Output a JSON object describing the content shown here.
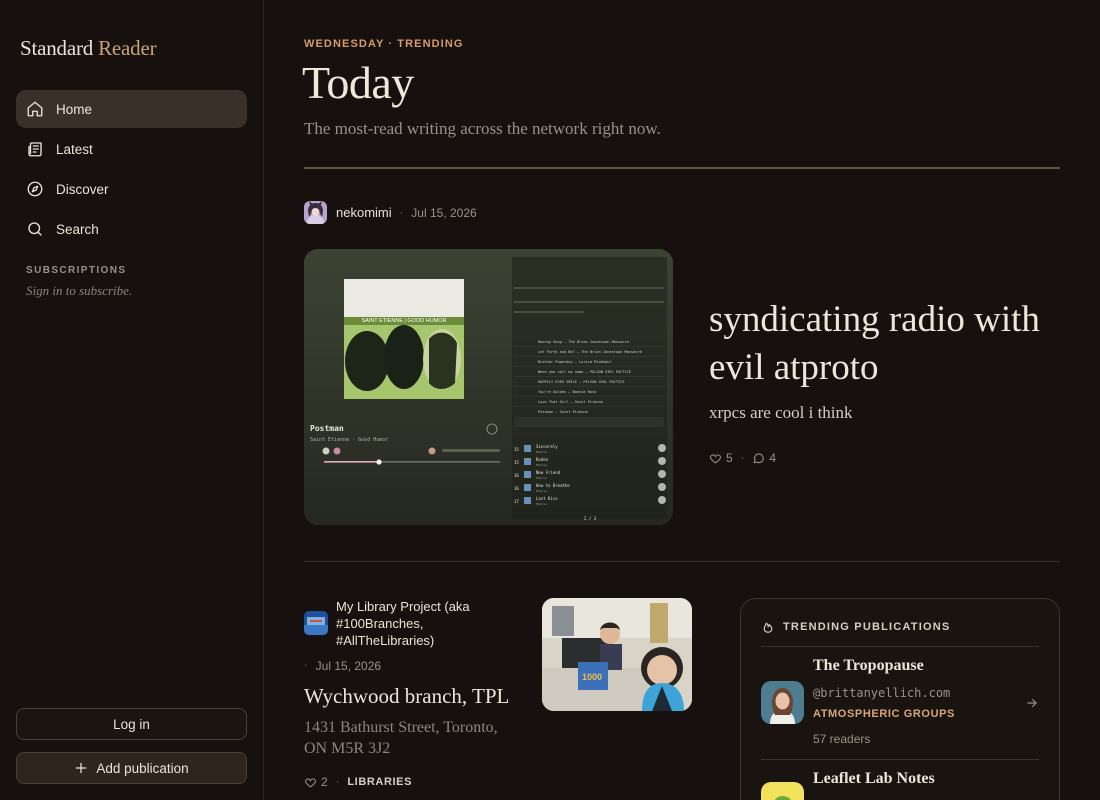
{
  "brand": {
    "part1": "Standard",
    "part2": "Reader"
  },
  "nav": {
    "items": [
      {
        "label": "Home",
        "icon": "home-icon",
        "active": true
      },
      {
        "label": "Latest",
        "icon": "newspaper-icon"
      },
      {
        "label": "Discover",
        "icon": "compass-icon"
      },
      {
        "label": "Search",
        "icon": "search-icon"
      }
    ]
  },
  "subscriptions": {
    "heading": "SUBSCRIPTIONS",
    "note": "Sign in to subscribe."
  },
  "buttons": {
    "login": "Log in",
    "add_publication": "Add publication"
  },
  "page": {
    "eyebrow": "WEDNESDAY · TRENDING",
    "title": "Today",
    "subtitle": "The most-read writing across the network right now."
  },
  "featured": {
    "author": "nekomimi",
    "date": "Jul 15, 2026",
    "title": "syndicating radio with evil atproto",
    "subtitle": "xrpcs are cool i think",
    "likes": "5",
    "comments": "4",
    "image": {
      "album_caption": "SAINT ETIENNE | GOOD HUMOR",
      "track": "Postman",
      "artist": "Saint Etienne · Good Humor",
      "queue": [
        "Hooray Song — The Brian Jonestown Massacre",
        "Let Forth and Be? — The Brian Jonestown Massacre",
        "Brother Paperboy — Lorica Blokhaul",
        "When you call my name — PELSON GIRL PACTICE",
        "HAPPILY EVER SMILE — PELSON GIRL PACTICE",
        "You're Golden — Nannie Rock",
        "Love That Girl — Saint Etienne",
        "Postman — Saint Etienne"
      ],
      "list": [
        {
          "n": "15",
          "title": "Sincerely",
          "sub": "Mobile"
        },
        {
          "n": "15",
          "title": "Rodeo",
          "sub": "Mobile"
        },
        {
          "n": "16",
          "title": "New Friend",
          "sub": "Mobile"
        },
        {
          "n": "16",
          "title": "How to Breathe",
          "sub": "Mobile"
        },
        {
          "n": "17",
          "title": "Last Kiss",
          "sub": "Mobile"
        }
      ],
      "pager": "2 / 3"
    }
  },
  "post2": {
    "publication": "My Library Project (aka #100Branches, #AllTheLibraries)",
    "date": "Jul 15, 2026",
    "title": "Wychwood branch, TPL",
    "subtitle": "1431 Bathurst Street, Toronto, ON M5R 3J2",
    "likes": "2",
    "tag": "LIBRARIES"
  },
  "trending": {
    "heading": "TRENDING PUBLICATIONS",
    "items": [
      {
        "name": "The Tropopause",
        "handle": "@brittanyellich.com",
        "category": "ATMOSPHERIC GROUPS",
        "readers": "57 readers"
      },
      {
        "name": "Leaflet Lab Notes"
      }
    ]
  },
  "colors": {
    "accent": "#d79c6c",
    "background": "#16110e",
    "active_nav": "#3a3027"
  }
}
